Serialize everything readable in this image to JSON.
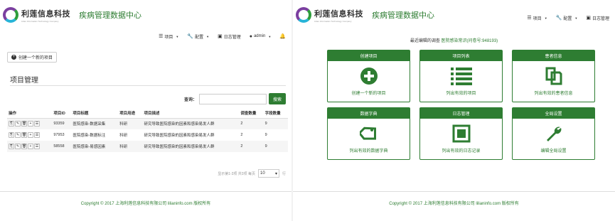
{
  "logo": {
    "name": "利莲信息科技",
    "en": "Lilian Information Technology Company"
  },
  "app_title": "疾病管理数据中心",
  "nav": {
    "projects": "项目",
    "config": "配置",
    "logs": "日志管理",
    "user": "admin"
  },
  "left": {
    "create_button": "创建一个新的项目",
    "section_title": "项目管理",
    "search_label": "查询：",
    "search_placeholder": "",
    "search_button": "搜索",
    "columns": [
      "操作",
      "项目ID",
      "项目标题",
      "项目用途",
      "项目描述",
      "调查数量",
      "字段数量"
    ],
    "rows": [
      {
        "id": "93359",
        "title": "医院感染-数据采集",
        "use": "科研",
        "desc": "研究导致医院感染的因素和感染易发人群",
        "surveys": "2",
        "fields": "9"
      },
      {
        "id": "97953",
        "title": "医院感染-数据标注",
        "use": "科研",
        "desc": "研究导致医院感染的因素和感染易发人群",
        "surveys": "2",
        "fields": "9"
      },
      {
        "id": "58558",
        "title": "医院感染-易感因素",
        "use": "科研",
        "desc": "研究导致医院感染的因素和感染易发人群",
        "surveys": "2",
        "fields": "9"
      }
    ],
    "pager_text": "显示第1-3项 共3项 每页",
    "page_size": "10",
    "pager_suffix": "行"
  },
  "right": {
    "recent_prefix": "最近编辑的调查",
    "recent_link": "医院感染常识(问卷号:948193)",
    "cards": [
      {
        "title": "创建项目",
        "icon": "plus-circle-icon",
        "desc": "创建一个新的项目"
      },
      {
        "title": "项目列表",
        "icon": "list-icon",
        "desc": "列出有效的项目"
      },
      {
        "title": "患者信息",
        "icon": "copy-icon",
        "desc": "列出有效的患者信息"
      },
      {
        "title": "数据字典",
        "icon": "tag-icon",
        "desc": "列出有效的数据字典"
      },
      {
        "title": "日志管理",
        "icon": "square-icon",
        "desc": "列出有效的日志记录"
      },
      {
        "title": "全局设置",
        "icon": "wrench-icon",
        "desc": "编辑全局设置"
      }
    ]
  },
  "footer": "Copyright © 2017  上海利莲信息科技有限公司 lilianinfo.com 版权所有",
  "colors": {
    "brand": "#2e7d32",
    "accent_purple": "#7b3fa0",
    "accent_blue": "#27b4d8"
  }
}
